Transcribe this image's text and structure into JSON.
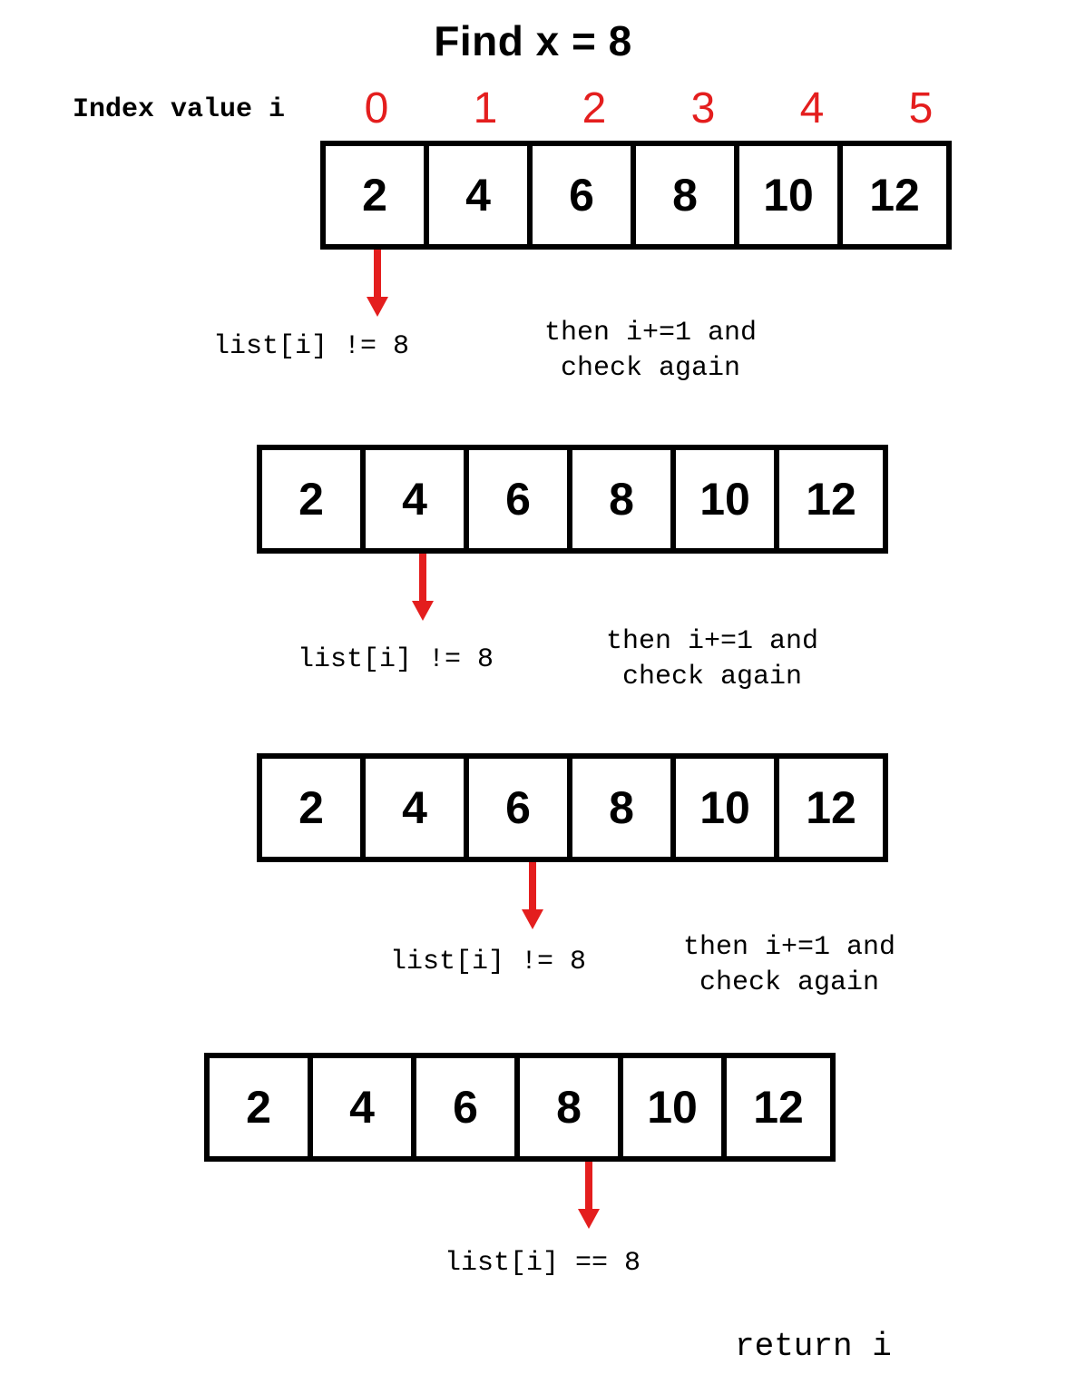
{
  "title": "Find x = 8",
  "index_label": "Index value i",
  "indices": [
    "0",
    "1",
    "2",
    "3",
    "4",
    "5"
  ],
  "array_values": [
    "2",
    "4",
    "6",
    "8",
    "10",
    "12"
  ],
  "steps": [
    {
      "check": "list[i] != 8",
      "action": "then i+=1 and\ncheck again"
    },
    {
      "check": "list[i] != 8",
      "action": "then i+=1 and\ncheck again"
    },
    {
      "check": "list[i] != 8",
      "action": "then i+=1 and\ncheck again"
    },
    {
      "check": "list[i] == 8",
      "action": ""
    }
  ],
  "result": "return i"
}
